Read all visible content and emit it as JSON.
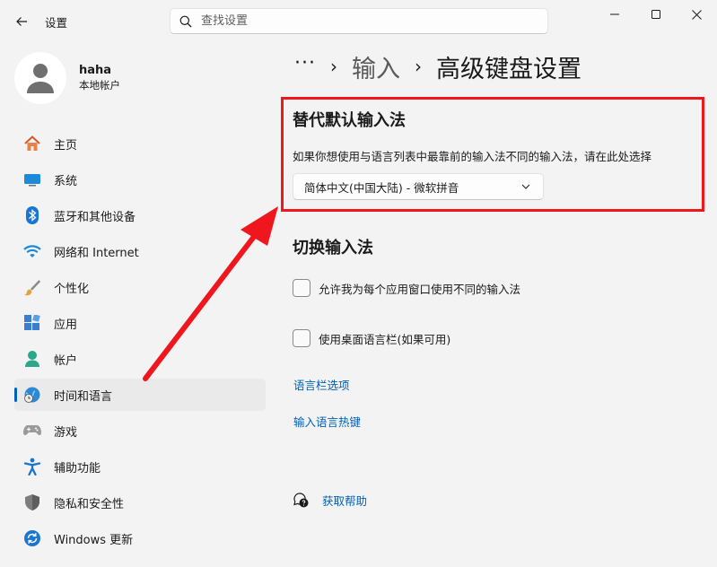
{
  "window": {
    "title": "设置",
    "controls": [
      "minimize",
      "maximize",
      "close"
    ]
  },
  "search": {
    "placeholder": "查找设置",
    "value": ""
  },
  "profile": {
    "name": "haha",
    "account_type": "本地帐户"
  },
  "sidebar": {
    "items": [
      {
        "label": "主页",
        "icon": "home-icon"
      },
      {
        "label": "系统",
        "icon": "monitor-icon"
      },
      {
        "label": "蓝牙和其他设备",
        "icon": "bluetooth-icon"
      },
      {
        "label": "网络和 Internet",
        "icon": "wifi-icon"
      },
      {
        "label": "个性化",
        "icon": "brush-icon"
      },
      {
        "label": "应用",
        "icon": "apps-icon"
      },
      {
        "label": "帐户",
        "icon": "account-icon"
      },
      {
        "label": "时间和语言",
        "icon": "globe-clock-icon",
        "active": true
      },
      {
        "label": "游戏",
        "icon": "gamepad-icon"
      },
      {
        "label": "辅助功能",
        "icon": "accessibility-icon"
      },
      {
        "label": "隐私和安全性",
        "icon": "shield-icon"
      },
      {
        "label": "Windows 更新",
        "icon": "update-icon"
      }
    ]
  },
  "breadcrumb": {
    "ellipsis": "···",
    "parent": "输入",
    "current": "高级键盘设置"
  },
  "override_input": {
    "title": "替代默认输入法",
    "description": "如果你想使用与语言列表中最靠前的输入法不同的输入法，请在此处选择",
    "selected": "简体中文(中国大陆) - 微软拼音"
  },
  "switch_input": {
    "title": "切换输入法",
    "options": [
      {
        "label": "允许我为每个应用窗口使用不同的输入法",
        "checked": false
      },
      {
        "label": "使用桌面语言栏(如果可用)",
        "checked": false
      }
    ]
  },
  "links": {
    "language_bar_options": "语言栏选项",
    "input_hotkeys": "输入语言热键"
  },
  "help": {
    "label": "获取帮助"
  },
  "colors": {
    "accent": "#005fb8",
    "link": "#0060b8",
    "annotation_red": "#f0161d",
    "background": "#f3f3f3"
  }
}
